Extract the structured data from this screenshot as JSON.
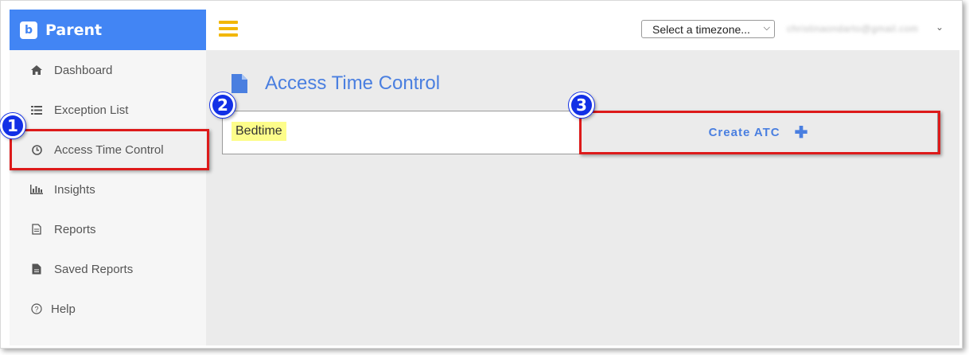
{
  "brand": {
    "name": "Parent",
    "logo_letter": "b",
    "color": "#4285f4"
  },
  "sidebar": {
    "items": [
      {
        "label": "Dashboard",
        "icon": "home-icon"
      },
      {
        "label": "Exception List",
        "icon": "list-icon"
      },
      {
        "label": "Access Time Control",
        "icon": "clock-icon"
      },
      {
        "label": "Insights",
        "icon": "bar-chart-icon"
      },
      {
        "label": "Reports",
        "icon": "document-icon"
      },
      {
        "label": "Saved Reports",
        "icon": "file-filled-icon"
      },
      {
        "label": "Help",
        "icon": "question-icon"
      }
    ]
  },
  "topbar": {
    "timezone_select": "Select a timezone...",
    "user_email": "christinaondarto@gmail.com"
  },
  "main": {
    "page_title": "Access Time Control",
    "atc_entry": "Bedtime",
    "create_button": "Create ATC"
  },
  "annotations": {
    "badge1": "1",
    "badge2": "2",
    "badge3": "3",
    "color": "#dd1a1a"
  }
}
